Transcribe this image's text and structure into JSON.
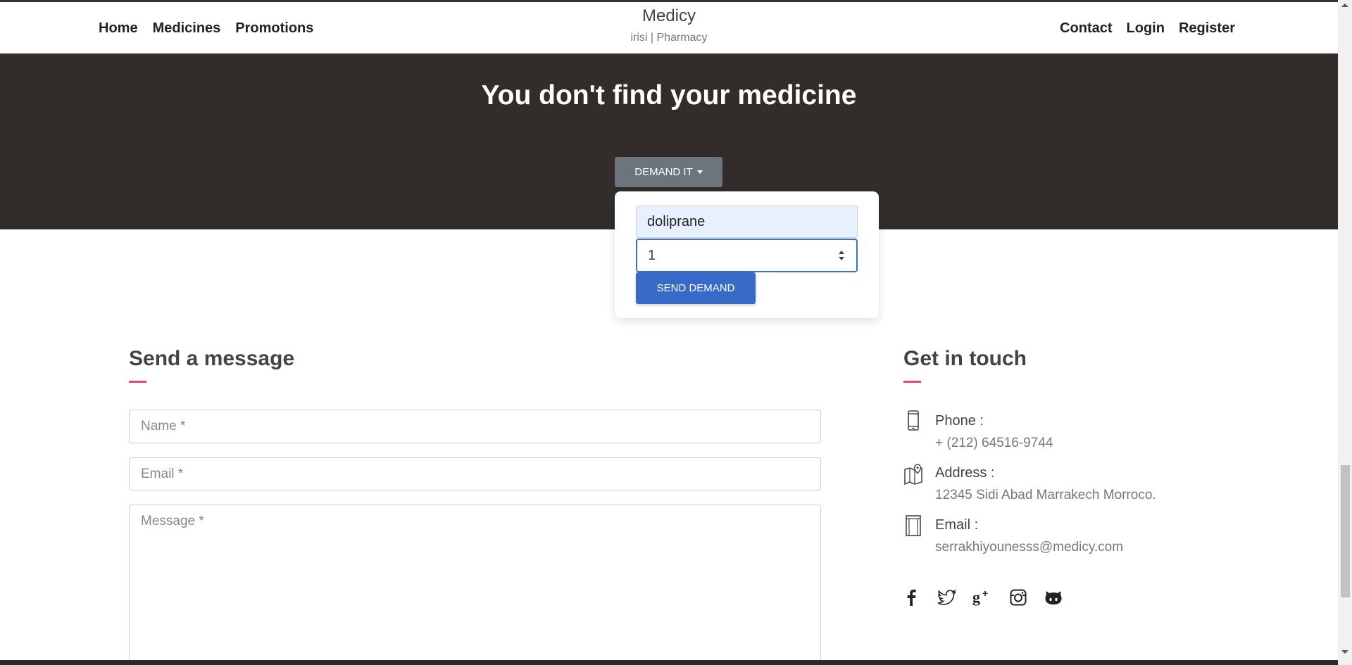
{
  "nav": {
    "left": [
      "Home",
      "Medicines",
      "Promotions"
    ],
    "right": [
      "Contact",
      "Login",
      "Register"
    ]
  },
  "brand": {
    "name": "Medicy",
    "tagline": "irisi | Pharmacy"
  },
  "hero": {
    "title": "You don't find your medicine",
    "demand_button": "DEMAND IT"
  },
  "demand_form": {
    "medicine_value": "doliprane",
    "quantity_value": "1",
    "send_button": "SEND DEMAND"
  },
  "message": {
    "title": "Send a message",
    "name_placeholder": "Name *",
    "email_placeholder": "Email *",
    "message_placeholder": "Message *"
  },
  "contact": {
    "title": "Get in touch",
    "phone_label": "Phone :",
    "phone_value": "+ (212) 64516-9744",
    "address_label": "Address :",
    "address_value": "12345 Sidi Abad Marrakech Morroco.",
    "email_label": "Email :",
    "email_value": "serrakhiyounesss@medicy.com"
  },
  "social": [
    "facebook-icon",
    "twitter-icon",
    "google-plus-icon",
    "instagram-icon",
    "github-icon"
  ],
  "colors": {
    "hero_bg": "#322c2b",
    "demand_btn": "#6c757d",
    "send_btn": "#3a6ac8",
    "accent": "#e84a6c",
    "autofill_bg": "#e8f0fe"
  }
}
